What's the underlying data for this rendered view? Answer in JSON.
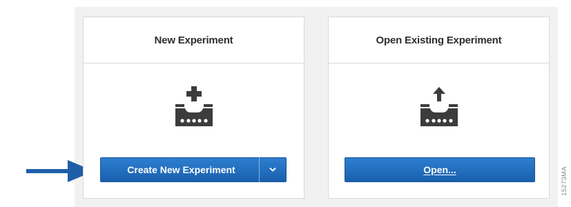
{
  "new_card": {
    "title": "New Experiment",
    "button_label": "Create New Experiment",
    "icon": "add-plate-icon",
    "dropdown_icon": "chevron-down-icon"
  },
  "open_card": {
    "title": "Open Existing Experiment",
    "button_label": "Open...",
    "icon": "upload-plate-icon"
  },
  "annotation": {
    "pointer": "arrow-right-icon",
    "figure_code": "15273MA"
  },
  "colors": {
    "button_blue": "#1f6dbf",
    "arrow_blue": "#1e5ea8",
    "icon_gray": "#3c3c3c",
    "background": "#f1f1f1"
  }
}
